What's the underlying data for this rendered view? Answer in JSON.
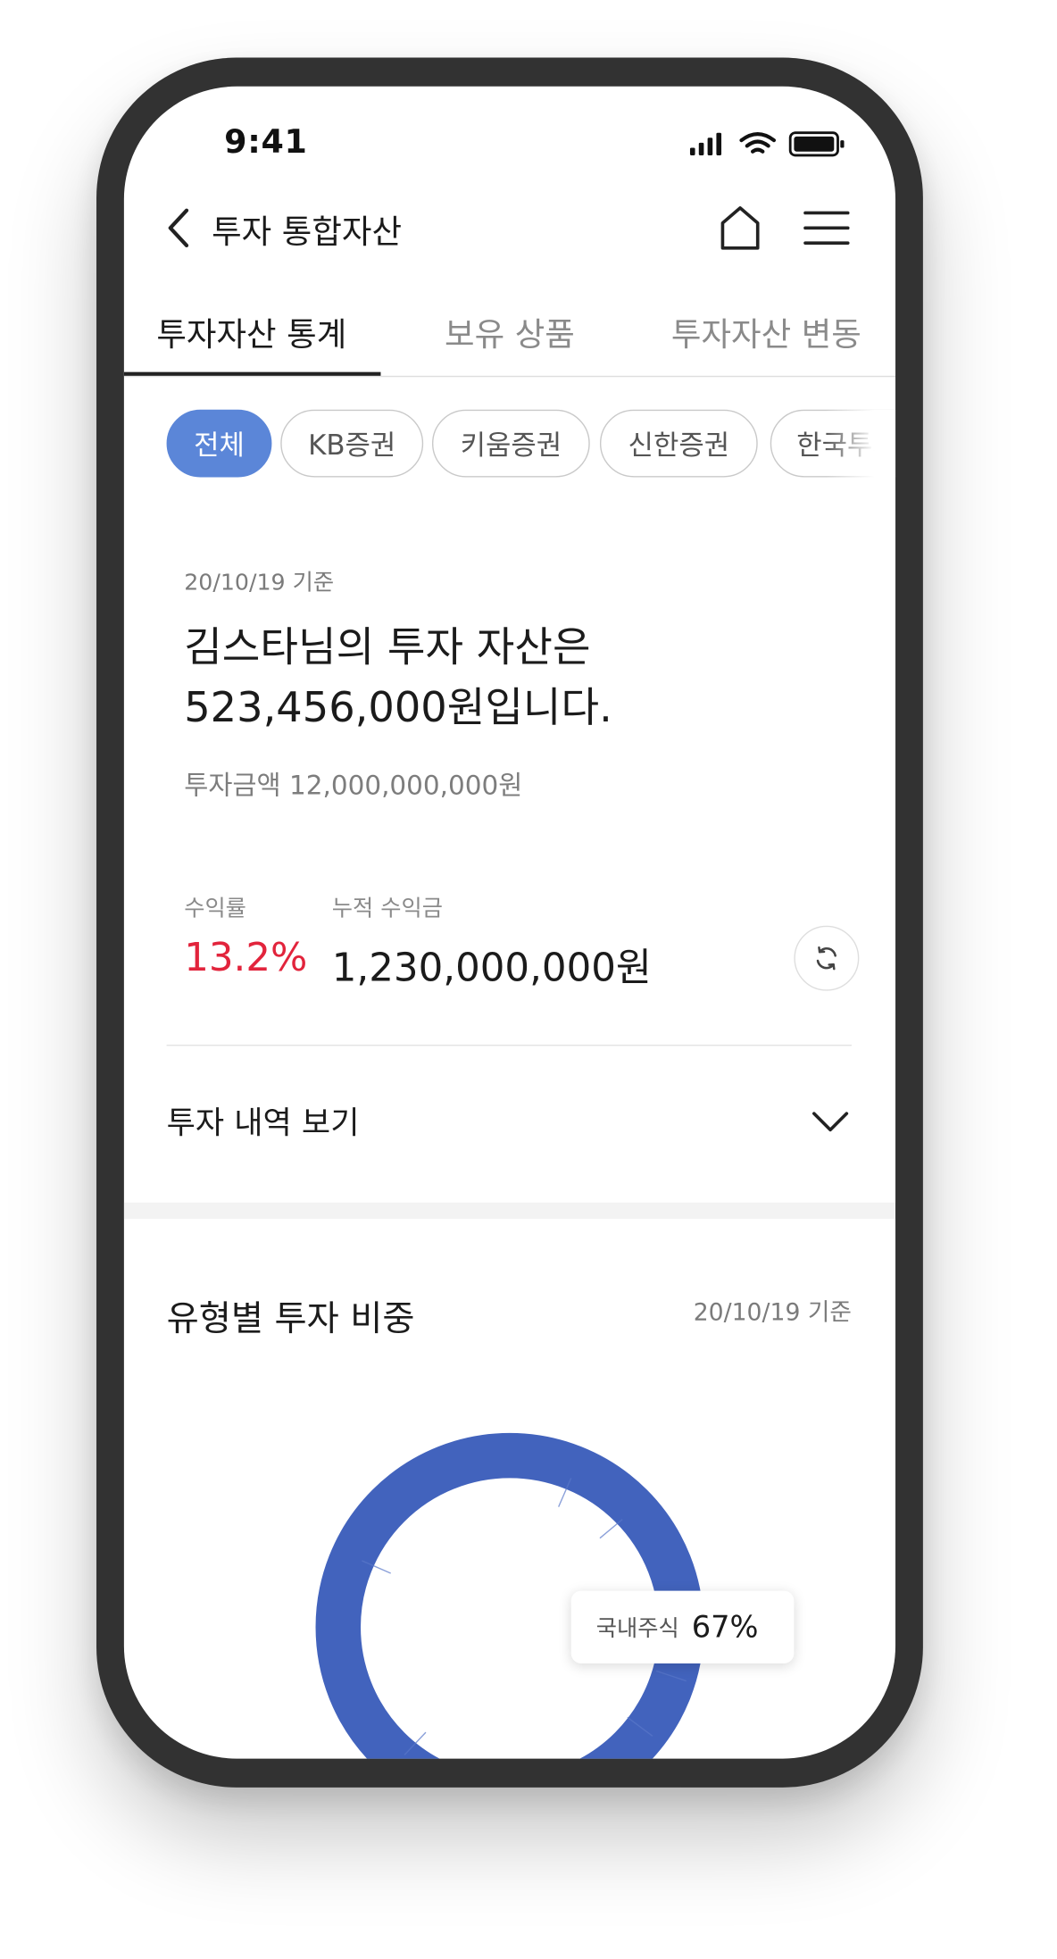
{
  "status_bar": {
    "time": "9:41"
  },
  "nav": {
    "title": "투자 통합자산"
  },
  "tabs": [
    {
      "label": "투자자산 통계",
      "active": true
    },
    {
      "label": "보유 상품",
      "active": false
    },
    {
      "label": "투자자산 변동",
      "active": false
    }
  ],
  "filter_chips": [
    {
      "label": "전체",
      "active": true
    },
    {
      "label": "KB증권",
      "active": false
    },
    {
      "label": "키움증권",
      "active": false
    },
    {
      "label": "신한증권",
      "active": false
    },
    {
      "label": "한국투자",
      "active": false
    }
  ],
  "summary": {
    "date": "20/10/19 기준",
    "headline_line1": "김스타님의 투자 자산은",
    "headline_line2": "523,456,000원입니다.",
    "invest_amount": "투자금액 12,000,000,000원",
    "rate_label": "수익률",
    "rate_value": "13.2%",
    "profit_label": "누적 수익금",
    "profit_value": "1,230,000,000원"
  },
  "history": {
    "label": "투자 내역 보기"
  },
  "allocation": {
    "title": "유형별 투자 비중",
    "date": "20/10/19 기준",
    "tooltip_name": "국내주식",
    "tooltip_value": "67%"
  },
  "colors": {
    "accent": "#5b86d8",
    "donut": "#4263bd",
    "rate": "#e2243c"
  },
  "icons": [
    "signal-icon",
    "wifi-icon",
    "battery-icon",
    "back-chevron-icon",
    "home-icon",
    "menu-icon",
    "refresh-icon",
    "chevron-down-icon"
  ]
}
